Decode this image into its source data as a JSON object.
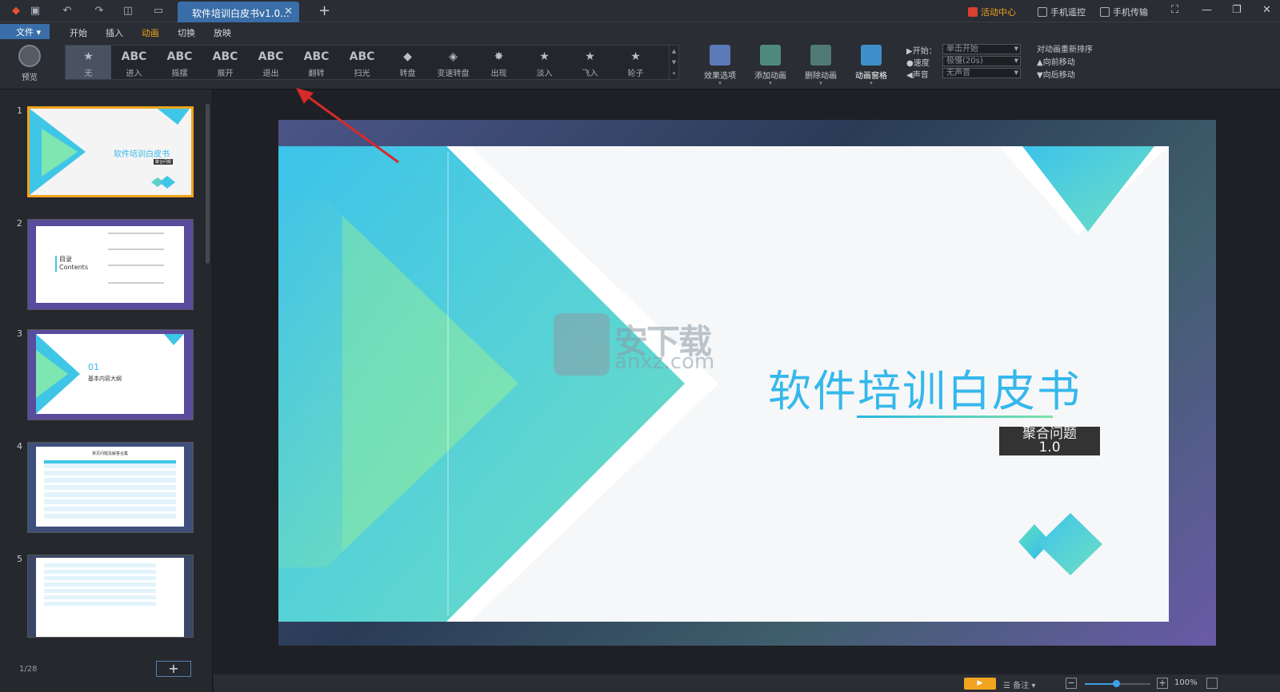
{
  "titlebar": {
    "doc_tab": "软件培训白皮书v1.0...",
    "activity": "活动中心",
    "remote": "手机遥控",
    "transfer": "手机传输"
  },
  "menubar": {
    "file": "文件",
    "items": [
      "开始",
      "插入",
      "动画",
      "切换",
      "放映"
    ],
    "active": "动画"
  },
  "ribbon": {
    "preview": "预览",
    "animations": [
      {
        "label": "无",
        "icon": "star-icon"
      },
      {
        "label": "进入",
        "icon": "abc-icon"
      },
      {
        "label": "摇摆",
        "icon": "abc-icon"
      },
      {
        "label": "展开",
        "icon": "abc-icon"
      },
      {
        "label": "退出",
        "icon": "abc-icon"
      },
      {
        "label": "翻转",
        "icon": "abc-icon"
      },
      {
        "label": "扫光",
        "icon": "abc-icon"
      },
      {
        "label": "转盘",
        "icon": "box-icon"
      },
      {
        "label": "变速转盘",
        "icon": "box-icon"
      },
      {
        "label": "出现",
        "icon": "burst-icon"
      },
      {
        "label": "淡入",
        "icon": "star-icon"
      },
      {
        "label": "飞入",
        "icon": "star-icon"
      },
      {
        "label": "轮子",
        "icon": "star-icon"
      }
    ],
    "selected_animation": "无",
    "effect_options": "效果选项",
    "add_animation": "添加动画",
    "delete_animation": "删除动画",
    "animation_grid": "动画窗格",
    "start_label": "开始：",
    "start_value": "单击开始",
    "speed_label": "速度",
    "speed_value": "极慢(20s)",
    "sound_label": "声音",
    "sound_value": "无声音",
    "reorder_title": "对动画重新排序",
    "move_forward": "向前移动",
    "move_backward": "向后移动"
  },
  "sidebar": {
    "slide_numbers": [
      "1",
      "2",
      "3",
      "4",
      "5"
    ],
    "slide1_title": "软件培训白皮书",
    "slide1_sub": "聚合问题",
    "slide2_title": "目录",
    "slide2_sub": "Contents",
    "slide3_num": "01",
    "slide3_title": "基本内容大纲",
    "slide4_title": "常见问题及解答合集",
    "page_indicator": "1/28",
    "add_slide": "+"
  },
  "slide": {
    "title": "软件培训白皮书",
    "subtitle_line1": "聚合问题",
    "subtitle_line2": "1.0"
  },
  "watermark": {
    "text": "安下载",
    "url": "anxz.com"
  },
  "status": {
    "notes": "备注",
    "zoom": "100%"
  }
}
